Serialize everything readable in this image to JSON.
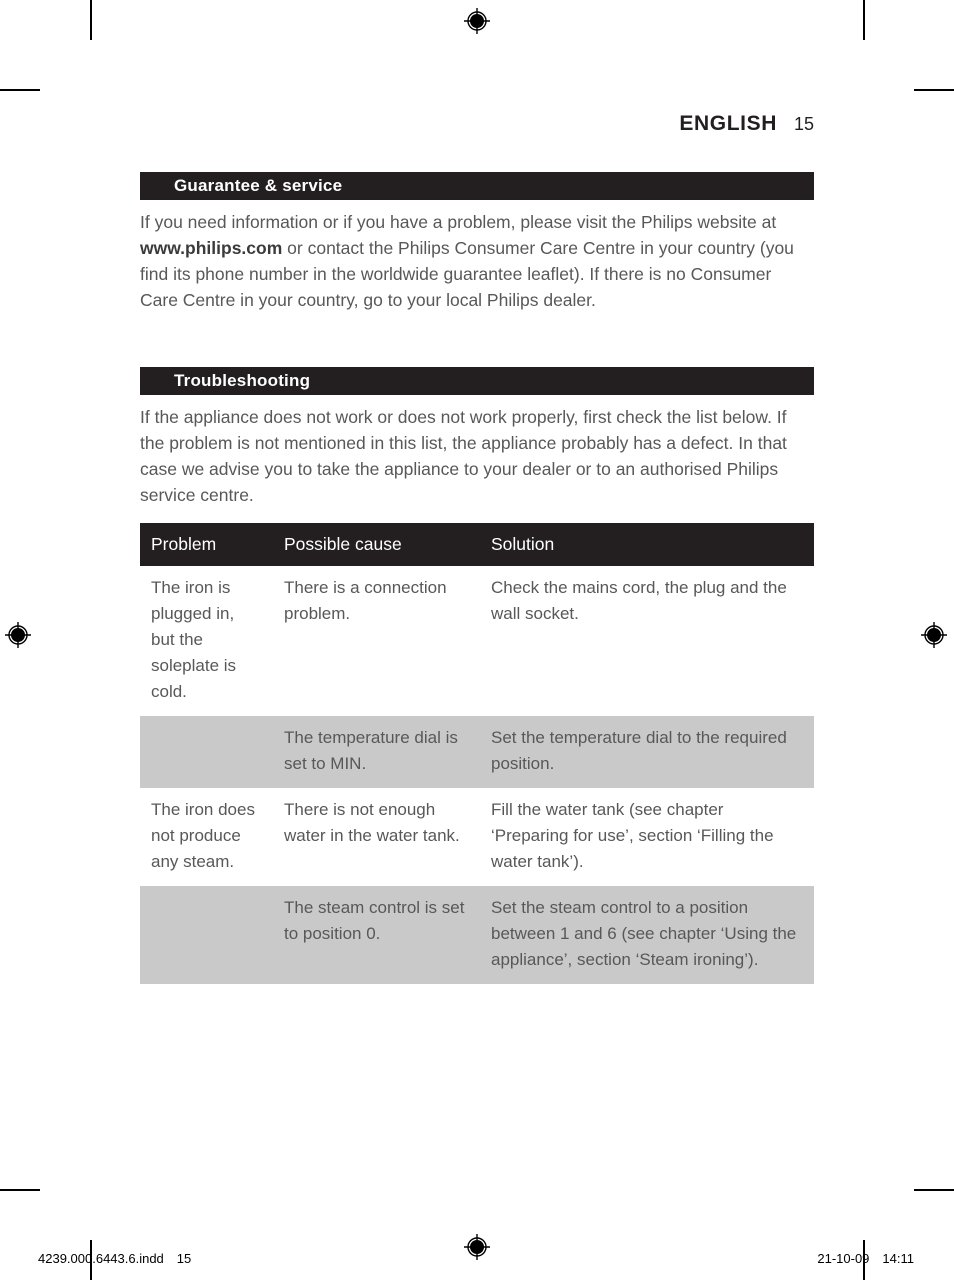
{
  "document": {
    "running_head": {
      "language": "ENGLISH",
      "page_number": "15"
    },
    "sections": [
      {
        "heading": "Guarantee & service",
        "paragraph_before_bold": "If you need information or if you have a problem, please visit the Philips website at ",
        "paragraph_bold": "www.philips.com",
        "paragraph_after_bold": " or contact the Philips Consumer Care Centre in your country (you find its phone number in the worldwide guarantee leaflet). If there is no Consumer Care Centre in your country, go to your local Philips dealer."
      },
      {
        "heading": "Troubleshooting",
        "paragraph": "If the appliance does not work or does not work properly, first check the list below. If the problem is not mentioned in this list, the appliance probably has a defect. In that case we advise you to take the appliance to your dealer or to an authorised Philips service centre."
      }
    ],
    "table": {
      "headers": [
        "Problem",
        "Possible cause",
        "Solution"
      ],
      "rows": [
        {
          "shade": "white",
          "problem": "The iron is plugged in, but the soleplate is cold.",
          "cause": "There is a connection problem.",
          "solution": "Check the mains cord, the plug and the wall socket."
        },
        {
          "shade": "gray",
          "problem": "",
          "cause": "The temperature dial is set to MIN.",
          "solution": "Set the temperature dial to the required position."
        },
        {
          "shade": "white",
          "problem": "The iron does not produce any steam.",
          "cause": "There is not enough water in the water tank.",
          "solution": "Fill the water tank (see chapter ‘Preparing for use’, section ‘Filling the water tank’)."
        },
        {
          "shade": "gray",
          "problem": "",
          "cause": "The steam control is set to position 0.",
          "solution": "Set the steam control to a position between 1 and 6 (see chapter ‘Using the appliance’, section ‘Steam ironing’)."
        }
      ]
    },
    "footer": {
      "file_name": "4239.000.6443.6.indd",
      "file_page": "15",
      "date": "21-10-09",
      "time": "14:11"
    },
    "print_marks": {
      "registration_mark_name": "registration-target-icon",
      "crop_mark_name": "crop-mark"
    },
    "colors": {
      "bar_background": "#231f20",
      "body_text": "#58585a",
      "row_shade": "#c9c9c9",
      "page_background": "#ffffff"
    }
  }
}
